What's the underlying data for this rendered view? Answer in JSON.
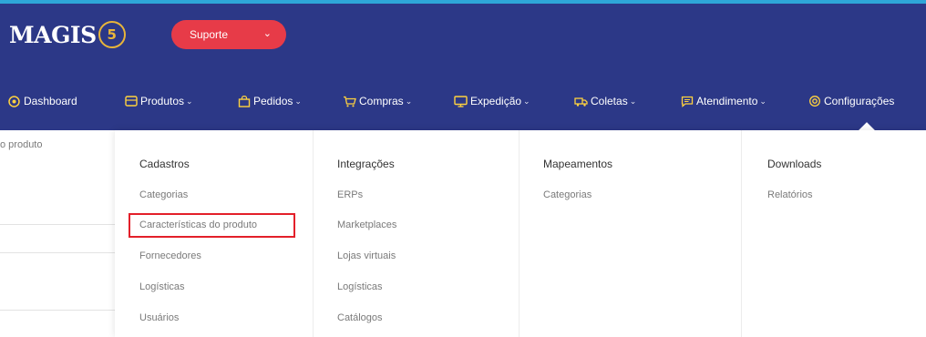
{
  "brand": {
    "logo_text": "MAGIS",
    "logo_badge": "5"
  },
  "support": {
    "label": "Suporte"
  },
  "nav": [
    {
      "label": "Dashboard",
      "icon": "dashboard-icon",
      "caret": ""
    },
    {
      "label": "Produtos",
      "icon": "box-icon",
      "caret": "⌄"
    },
    {
      "label": "Pedidos",
      "icon": "shopping-bag-icon",
      "caret": "⌄"
    },
    {
      "label": "Compras",
      "icon": "cart-icon",
      "caret": "⌄"
    },
    {
      "label": "Expedição",
      "icon": "monitor-icon",
      "caret": "⌄"
    },
    {
      "label": "Coletas",
      "icon": "truck-icon",
      "caret": "⌄"
    },
    {
      "label": "Atendimento",
      "icon": "chat-icon",
      "caret": "⌄"
    },
    {
      "label": "Configurações",
      "icon": "gear-icon",
      "caret": ""
    }
  ],
  "background_text": "o produto",
  "menu": {
    "columns": [
      {
        "title": "Cadastros",
        "items": [
          "Categorias",
          "Características do produto",
          "Fornecedores",
          "Logísticas",
          "Usuários"
        ]
      },
      {
        "title": "Integrações",
        "items": [
          "ERPs",
          "Marketplaces",
          "Lojas virtuais",
          "Logísticas",
          "Catálogos"
        ]
      },
      {
        "title": "Mapeamentos",
        "items": [
          "Categorias"
        ]
      },
      {
        "title": "Downloads",
        "items": [
          "Relatórios"
        ]
      }
    ]
  },
  "colors": {
    "header": "#2c3887",
    "accent": "#e73b48",
    "highlight_border": "#e3202a"
  }
}
